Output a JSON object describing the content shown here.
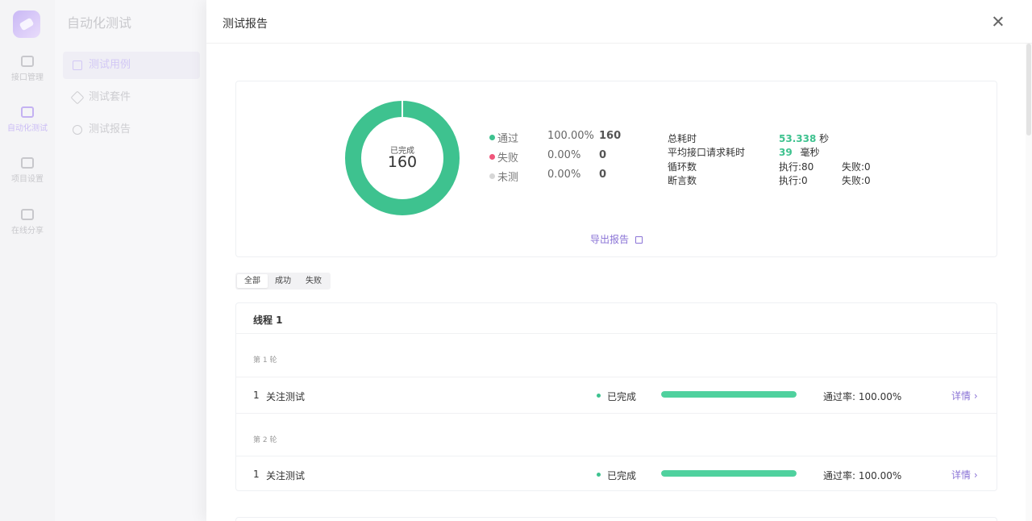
{
  "app": {
    "title": "自动化测试",
    "rail": [
      {
        "label": "接口管理"
      },
      {
        "label": "自动化测试"
      },
      {
        "label": "项目设置"
      },
      {
        "label": "在线分享"
      }
    ],
    "nav": [
      {
        "label": "测试用例"
      },
      {
        "label": "测试套件"
      },
      {
        "label": "测试报告"
      }
    ]
  },
  "drawer": {
    "title": "测试报告"
  },
  "summary": {
    "donut_label": "已完成",
    "donut_total": "160",
    "legend": [
      {
        "name": "通过",
        "pct": "100.00%",
        "count": "160",
        "color": "#3ec28f"
      },
      {
        "name": "失败",
        "pct": "0.00%",
        "count": "0",
        "color": "#f0557a"
      },
      {
        "name": "未测",
        "pct": "0.00%",
        "count": "0",
        "color": "#d6d6d6"
      }
    ],
    "stats": {
      "total_time_label": "总耗时",
      "total_time_value": "53.338",
      "total_time_unit": "秒",
      "avg_time_label": "平均接口请求耗时",
      "avg_time_value": "39",
      "avg_time_unit": "毫秒",
      "loop_label": "循环数",
      "loop_exec": "执行:80",
      "loop_fail": "失败:0",
      "assert_label": "断言数",
      "assert_exec": "执行:0",
      "assert_fail": "失败:0"
    },
    "export_label": "导出报告"
  },
  "filters": [
    "全部",
    "成功",
    "失败"
  ],
  "thread": {
    "title": "线程 1",
    "rounds": [
      {
        "label": "第 1 轮",
        "cases": [
          {
            "idx": "1",
            "name": "关注测试",
            "status": "已完成",
            "progress": 1.0,
            "pass_rate": "通过率: 100.00%",
            "detail": "详情 ›"
          }
        ]
      },
      {
        "label": "第 2 轮",
        "cases": [
          {
            "idx": "1",
            "name": "关注测试",
            "status": "已完成",
            "progress": 1.0,
            "pass_rate": "通过率: 100.00%",
            "detail": "详情 ›"
          }
        ]
      }
    ]
  },
  "chart_data": {
    "type": "pie",
    "categories": [
      "通过",
      "失败",
      "未测"
    ],
    "values": [
      160,
      0,
      0
    ],
    "title": "",
    "center_label": "已完成",
    "center_value": 160
  },
  "colors": {
    "accent": "#8a73d6",
    "success": "#3ec28f",
    "fail": "#f0557a",
    "untested": "#d6d6d6"
  }
}
